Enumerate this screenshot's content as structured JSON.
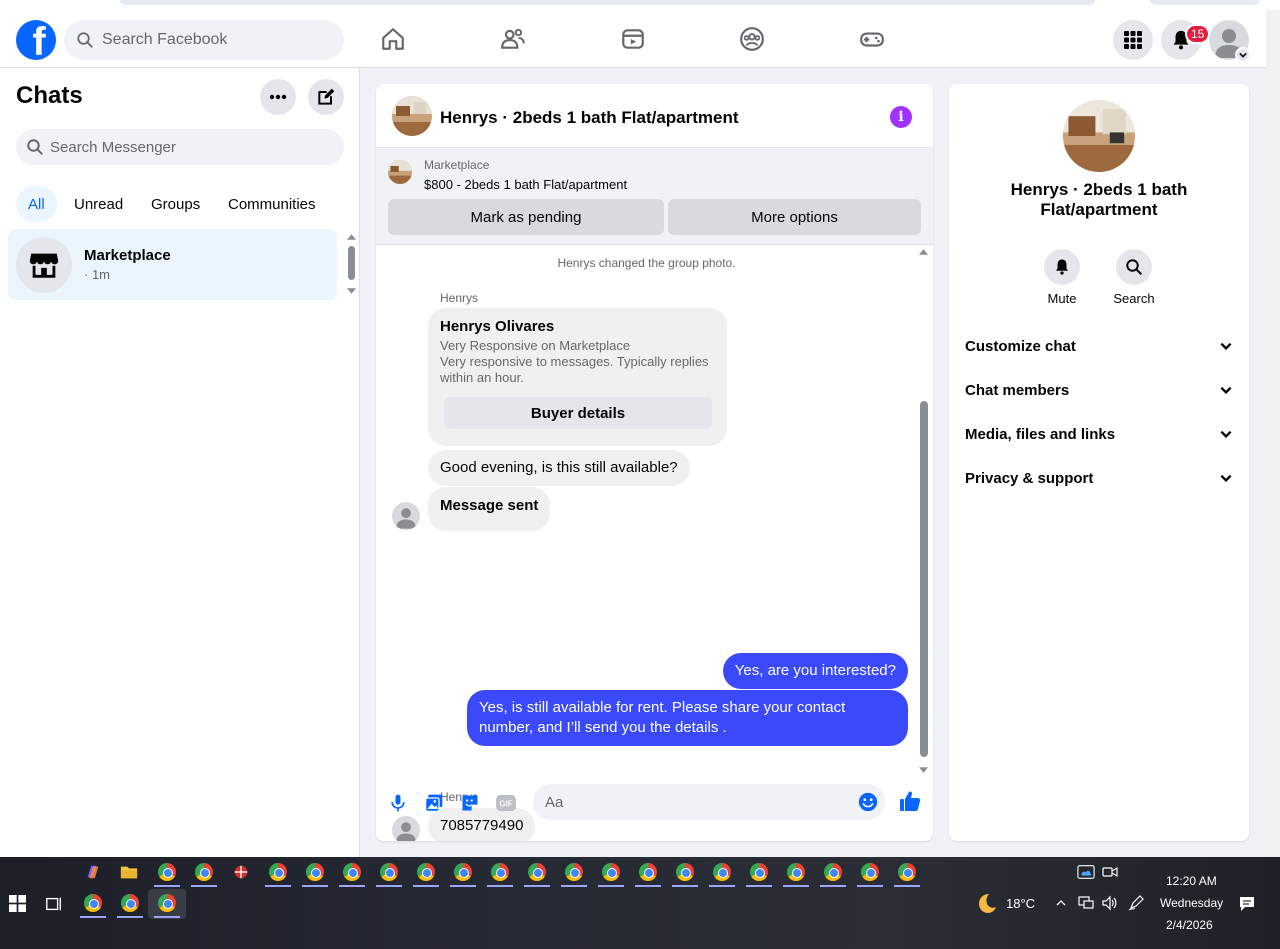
{
  "header": {
    "search_placeholder": "Search Facebook",
    "notification_count": "15",
    "brand_color": "#0866ff"
  },
  "left": {
    "title": "Chats",
    "search_placeholder": "Search Messenger",
    "filters": [
      "All",
      "Unread",
      "Groups",
      "Communities"
    ],
    "active_filter": "All",
    "chats": [
      {
        "name": "Marketplace",
        "time": "· 1m"
      }
    ]
  },
  "chat": {
    "title": "Henrys · 2beds 1 bath Flat/apartment",
    "banner": {
      "label": "Marketplace",
      "listing": "$800 - 2beds 1 bath Flat/apartment",
      "mark_pending": "Mark as pending",
      "more_options": "More options"
    },
    "system_message": "Henrys changed the group photo.",
    "sender_1": "Henrys",
    "profile": {
      "name": "Henrys Olivares",
      "line1": "Very Responsive on Marketplace",
      "line2": "Very responsive to messages. Typically replies within an hour.",
      "button": "Buyer details"
    },
    "incoming_1": "Good evening, is this still available?",
    "incoming_2": "Message sent",
    "outgoing_1": "Yes, are you interested?",
    "outgoing_2": "Yes, is still available for rent. Please share your contact number, and I’ll send you the details .",
    "sender_2": "Henrys",
    "incoming_3": "7085779490",
    "composer_placeholder": "Aa",
    "outgoing_color": "#3a49f9"
  },
  "info": {
    "title": "Henrys · 2beds 1 bath Flat/apartment",
    "actions": [
      "Mute",
      "Search"
    ],
    "sections": [
      "Customize chat",
      "Chat members",
      "Media, files and links",
      "Privacy & support"
    ]
  },
  "taskbar": {
    "temperature": "18°C",
    "time": "12:20 AM",
    "day": "Wednesday",
    "date": "2/4/2026"
  }
}
